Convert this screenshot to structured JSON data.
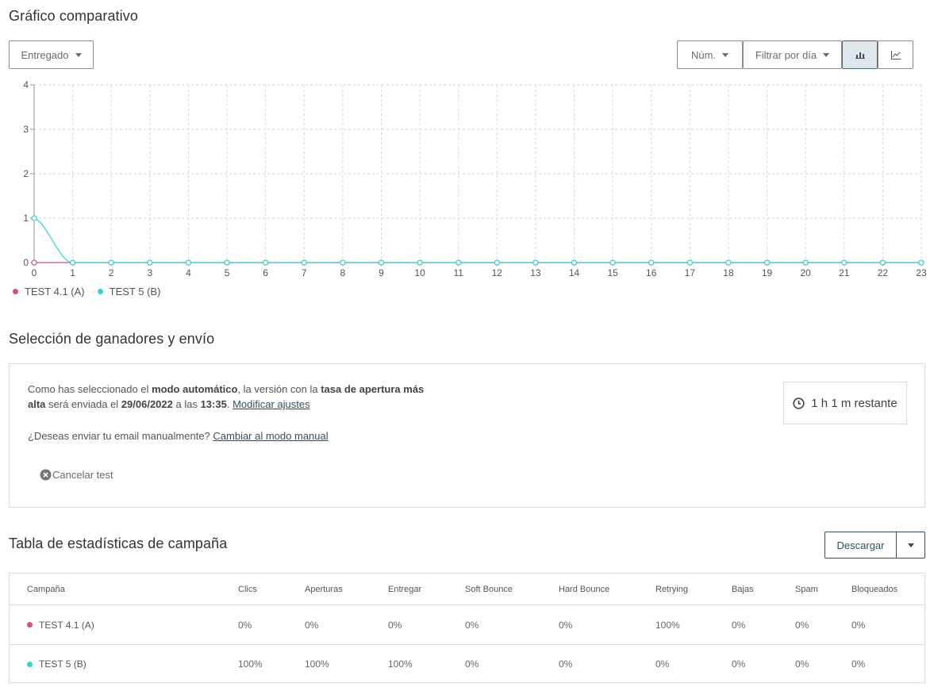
{
  "comparative": {
    "title": "Gráfico comparativo",
    "metric_dropdown": "Entregado",
    "mode_dropdown": "Núm.",
    "filter_dropdown": "Filtrar por día"
  },
  "chart_data": {
    "type": "line",
    "x": [
      0,
      1,
      2,
      3,
      4,
      5,
      6,
      7,
      8,
      9,
      10,
      11,
      12,
      13,
      14,
      15,
      16,
      17,
      18,
      19,
      20,
      21,
      22,
      23
    ],
    "ylim": [
      0,
      4
    ],
    "yticks": [
      0,
      1,
      2,
      3,
      4
    ],
    "grid": true,
    "legend_placement": "bottom-left",
    "series": [
      {
        "name": "TEST 4.1 (A)",
        "color": "#d0527f",
        "values": [
          0,
          0,
          0,
          0,
          0,
          0,
          0,
          0,
          0,
          0,
          0,
          0,
          0,
          0,
          0,
          0,
          0,
          0,
          0,
          0,
          0,
          0,
          0,
          0
        ]
      },
      {
        "name": "TEST 5 (B)",
        "color": "#2fd5d5",
        "values": [
          1,
          0,
          0,
          0,
          0,
          0,
          0,
          0,
          0,
          0,
          0,
          0,
          0,
          0,
          0,
          0,
          0,
          0,
          0,
          0,
          0,
          0,
          0,
          0
        ]
      }
    ]
  },
  "selection": {
    "title": "Selección de ganadores y envío",
    "text_1": "Como has seleccionado el ",
    "bold_1": "modo automático",
    "text_2": ", la versión con la ",
    "bold_2": "tasa de apertura más alta",
    "text_3": " será enviada el ",
    "bold_3": "29/06/2022",
    "text_4": " a las ",
    "bold_4": "13:35",
    "text_5": ". ",
    "modify_link": "Modificar ajustes",
    "manual_question": "¿Deseas enviar tu email manualmente? ",
    "manual_link": "Cambiar al modo manual",
    "cancel_label": "Cancelar test",
    "timer": "1 h 1 m restante"
  },
  "stats": {
    "title": "Tabla de estadísticas de campaña",
    "download_label": "Descargar",
    "columns": [
      "Campaña",
      "Clics",
      "Aperturas",
      "Entregar",
      "Soft Bounce",
      "Hard Bounce",
      "Retrying",
      "Bajas",
      "Spam",
      "Bloqueados"
    ],
    "rows": [
      {
        "name": "TEST 4.1 (A)",
        "color": "#d0527f",
        "values": [
          "0%",
          "0%",
          "0%",
          "0%",
          "0%",
          "100%",
          "0%",
          "0%",
          "0%"
        ]
      },
      {
        "name": "TEST 5 (B)",
        "color": "#2fd5d5",
        "values": [
          "100%",
          "100%",
          "100%",
          "0%",
          "0%",
          "0%",
          "0%",
          "0%",
          "0%"
        ]
      }
    ]
  }
}
